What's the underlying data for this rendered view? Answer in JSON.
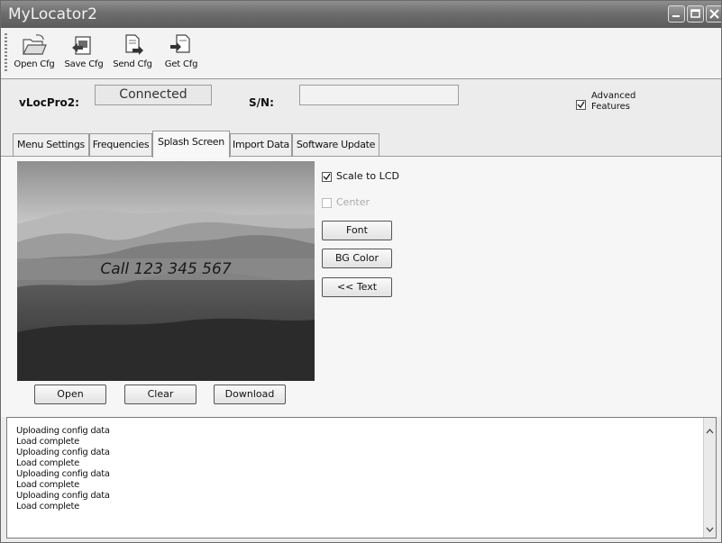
{
  "window": {
    "title": "MyLocator2"
  },
  "toolbar": {
    "buttons": [
      {
        "label": "Open Cfg",
        "icon": "folder-open-icon"
      },
      {
        "label": "Save Cfg",
        "icon": "save-icon"
      },
      {
        "label": "Send Cfg",
        "icon": "send-document-icon"
      },
      {
        "label": "Get Cfg",
        "icon": "get-document-icon"
      }
    ]
  },
  "status": {
    "device_label": "vLocPro2:",
    "connection_value": "Connected",
    "serial_label": "S/N:",
    "serial_value": "",
    "advanced_label_line1": "Advanced",
    "advanced_label_line2": "Features",
    "advanced_checked": true
  },
  "tabs": [
    {
      "label": "Menu Settings",
      "active": false
    },
    {
      "label": "Frequencies",
      "active": false
    },
    {
      "label": "Splash Screen",
      "active": true
    },
    {
      "label": "Import Data",
      "active": false
    },
    {
      "label": "Software Update",
      "active": false
    }
  ],
  "splash": {
    "overlay_text": "Call 123 345 567",
    "open_label": "Open",
    "clear_label": "Clear",
    "download_label": "Download",
    "scale_label": "Scale to LCD",
    "scale_checked": true,
    "center_label": "Center",
    "center_checked": false,
    "font_label": "Font",
    "bgcolor_label": "BG Color",
    "text_label": "<< Text"
  },
  "log": {
    "lines": [
      "Uploading config data",
      "Load complete",
      "Uploading config data",
      "Load complete",
      "Uploading config data",
      "Load complete",
      "Uploading config data",
      "Load complete"
    ]
  }
}
